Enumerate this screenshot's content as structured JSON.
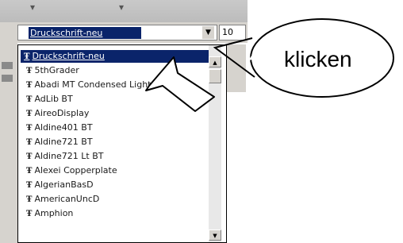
{
  "toolbar": {
    "font_name_value": "Druckschrift-neu",
    "font_size_value": "10",
    "dropdown_arrow": "▼"
  },
  "font_list": {
    "selected": "Druckschrift-neu",
    "items": [
      "5thGrader",
      "Abadi MT Condensed Light",
      "AdLib BT",
      "AireoDisplay",
      "Aldine401 BT",
      "Aldine721 BT",
      "Aldine721 Lt BT",
      "Alexei Copperplate",
      "AlgerianBasD",
      "AmericanUncD",
      "Amphion"
    ],
    "truetype_glyph": "Ŧ"
  },
  "callout": {
    "text": "klicken"
  }
}
